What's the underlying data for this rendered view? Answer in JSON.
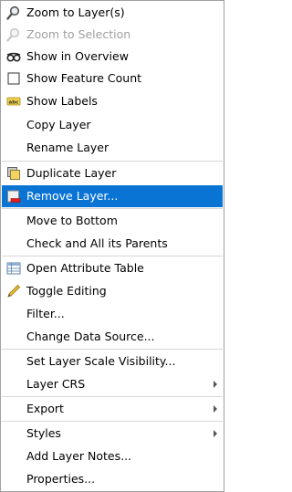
{
  "menu": {
    "items": [
      {
        "label": "Zoom to Layer(s)",
        "icon": "zoom-layer-icon",
        "enabled": true
      },
      {
        "label": "Zoom to Selection",
        "icon": "zoom-selection-icon",
        "enabled": false
      },
      {
        "label": "Show in Overview",
        "icon": "overview-glasses-icon",
        "enabled": true
      },
      {
        "label": "Show Feature Count",
        "icon": "checkbox-icon",
        "enabled": true
      },
      {
        "label": "Show Labels",
        "icon": "labels-abc-icon",
        "enabled": true
      },
      {
        "label": "Copy Layer",
        "enabled": true
      },
      {
        "label": "Rename Layer",
        "enabled": true
      },
      {
        "label": "Duplicate Layer",
        "icon": "duplicate-icon",
        "enabled": true
      },
      {
        "label": "Remove Layer...",
        "icon": "remove-layer-icon",
        "enabled": true,
        "highlighted": true
      },
      {
        "label": "Move to Bottom",
        "enabled": true
      },
      {
        "label": "Check and All its Parents",
        "enabled": true
      },
      {
        "label": "Open Attribute Table",
        "icon": "attribute-table-icon",
        "enabled": true
      },
      {
        "label": "Toggle Editing",
        "icon": "pencil-icon",
        "enabled": true
      },
      {
        "label": "Filter...",
        "enabled": true
      },
      {
        "label": "Change Data Source...",
        "enabled": true
      },
      {
        "label": "Set Layer Scale Visibility...",
        "enabled": true
      },
      {
        "label": "Layer CRS",
        "enabled": true,
        "submenu": true
      },
      {
        "label": "Export",
        "enabled": true,
        "submenu": true
      },
      {
        "label": "Styles",
        "enabled": true,
        "submenu": true
      },
      {
        "label": "Add Layer Notes...",
        "enabled": true
      },
      {
        "label": "Properties...",
        "enabled": true
      }
    ]
  },
  "colors": {
    "highlight": "#0a74d4",
    "disabled_text": "#a0a0a0",
    "separator": "#d7d7d7"
  }
}
